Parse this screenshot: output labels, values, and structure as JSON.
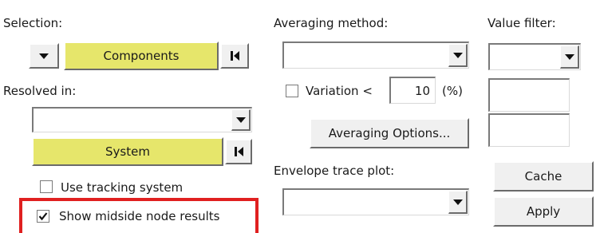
{
  "selection": {
    "label": "Selection:",
    "value": "Components"
  },
  "resolved_in": {
    "label": "Resolved in:",
    "value": "",
    "system_button": "System"
  },
  "tracking": {
    "label": "Use tracking system",
    "checked": false
  },
  "midside": {
    "label": "Show midside node results",
    "checked": true,
    "highlight_color": "#e02020"
  },
  "averaging": {
    "label": "Averaging method:",
    "value": "",
    "variation_label": "Variation <",
    "variation_value": "10",
    "variation_unit": "(%)",
    "variation_checked": false,
    "options_button": "Averaging Options..."
  },
  "envelope": {
    "label": "Envelope trace plot:",
    "value": ""
  },
  "value_filter": {
    "label": "Value filter:",
    "value": "",
    "min": "",
    "max": ""
  },
  "buttons": {
    "cache": "Cache",
    "apply": "Apply"
  },
  "colors": {
    "accent_yellow": "#e6e66b",
    "face": "#f0f0f0"
  },
  "icons": {
    "dropdown": "chevron-down-icon",
    "first": "skip-to-start-icon",
    "check": "checkmark-icon"
  }
}
